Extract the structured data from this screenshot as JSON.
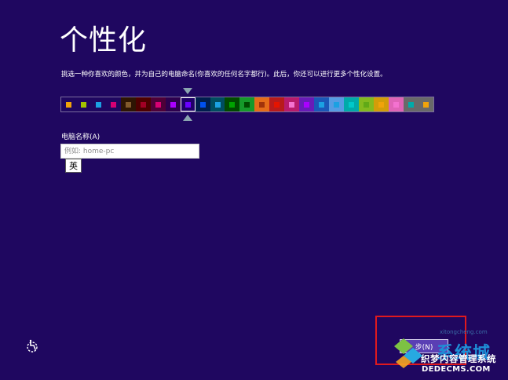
{
  "header": {
    "title": "个性化"
  },
  "description": "挑选一种你喜欢的颜色，并为自己的电脑命名(你喜欢的任何名字都行)。此后，你还可以进行更多个性化设置。",
  "color_picker": {
    "selected_index": 8,
    "swatches": [
      {
        "bg": "#1f0760",
        "dot": "#f0a30a"
      },
      {
        "bg": "#1f0760",
        "dot": "#a4c400"
      },
      {
        "bg": "#1f0760",
        "dot": "#1ba1e2"
      },
      {
        "bg": "#1f0760",
        "dot": "#d80073"
      },
      {
        "bg": "#2e1503",
        "dot": "#825a2c"
      },
      {
        "bg": "#4e0000",
        "dot": "#a20025"
      },
      {
        "bg": "#4e0038",
        "dot": "#d80073"
      },
      {
        "bg": "#2d004e",
        "dot": "#aa00ff"
      },
      {
        "bg": "#1f0068",
        "dot": "#6a00ff"
      },
      {
        "bg": "#001e4e",
        "dot": "#0050ef"
      },
      {
        "bg": "#004d60",
        "dot": "#1ba1e2"
      },
      {
        "bg": "#004a00",
        "dot": "#00a300"
      },
      {
        "bg": "#15992a",
        "dot": "#004a00"
      },
      {
        "bg": "#e56c19",
        "dot": "#a0330b"
      },
      {
        "bg": "#b81b1b",
        "dot": "#e51400"
      },
      {
        "bg": "#b81b6c",
        "dot": "#f472d0"
      },
      {
        "bg": "#691bb8",
        "dot": "#aa00ff"
      },
      {
        "bg": "#1b58b8",
        "dot": "#1ba1e2"
      },
      {
        "bg": "#569ce3",
        "dot": "#1ba1e2"
      },
      {
        "bg": "#00aaaa",
        "dot": "#00c9c9"
      },
      {
        "bg": "#83ba1f",
        "dot": "#60a917"
      },
      {
        "bg": "#d39d09",
        "dot": "#f0a30a"
      },
      {
        "bg": "#e064b7",
        "dot": "#f472d0"
      },
      {
        "bg": "#696969",
        "dot": "#00aba9"
      },
      {
        "bg": "#696969",
        "dot": "#f0a30a"
      }
    ]
  },
  "pc_name": {
    "label": "电脑名称(A)",
    "value": "",
    "placeholder": "例如: home-pc"
  },
  "ime_indicator": "英",
  "accessibility_icon": "ease-of-access-icon",
  "next_button": {
    "label": "步(N)"
  },
  "watermark": {
    "brand": "系统城",
    "sub": "xitongcheng.com",
    "line1": "织梦内容管理系统",
    "line2": "DEDECMS.COM"
  },
  "colors": {
    "background": "#1f0760",
    "highlight": "#e0191e"
  }
}
